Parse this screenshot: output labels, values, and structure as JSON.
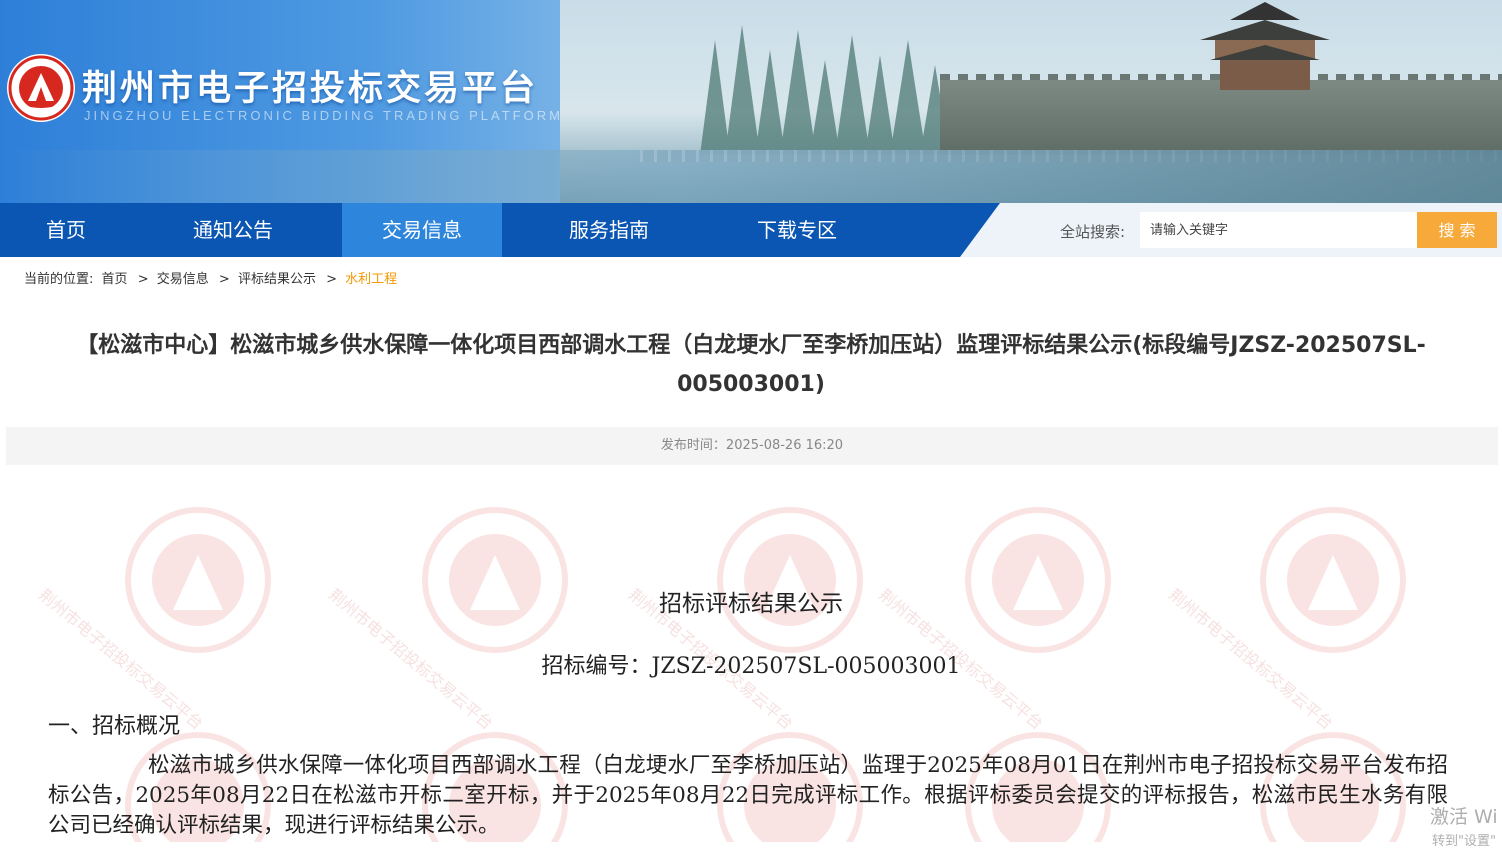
{
  "header": {
    "site_title": "荆州市电子招投标交易平台",
    "site_subtitle": "JINGZHOU ELECTRONIC BIDDING TRADING PLATFORM"
  },
  "nav": {
    "items": [
      {
        "label": "首页"
      },
      {
        "label": "通知公告"
      },
      {
        "label": "交易信息"
      },
      {
        "label": "服务指南"
      },
      {
        "label": "下载专区"
      }
    ],
    "active": "交易信息"
  },
  "search": {
    "label": "全站搜索:",
    "placeholder": "请输入关键字",
    "button": "搜 索"
  },
  "breadcrumb": {
    "prefix": "当前的位置:",
    "items": [
      "首页",
      "交易信息",
      "评标结果公示",
      "水利工程"
    ],
    "separator": ">"
  },
  "article": {
    "title": "【松滋市中心】松滋市城乡供水保障一体化项目西部调水工程（白龙埂水厂至李桥加压站）监理评标结果公示(标段编号JZSZ-202507SL-005003001)",
    "publish_time": "发布时间：2025-08-26 16:20"
  },
  "document": {
    "heading": "招标评标结果公示",
    "code": "招标编号：JZSZ-202507SL-005003001",
    "section_1_title": "一、招标概况",
    "section_1_text": "松滋市城乡供水保障一体化项目西部调水工程（白龙埂水厂至李桥加压站）监理于2025年08月01日在荆州市电子招投标交易平台发布招标公告，2025年08月22日在松滋市开标二室开标，并于2025年08月22日完成评标工作。根据评标委员会提交的评标报告，松滋市民生水务有限公司已经确认评标结果，现进行评标结果公示。"
  },
  "watermark": {
    "text": "荆州市电子招投标交易云平台"
  },
  "os_overlay": {
    "line1": "激活 Wi",
    "line2": "转到\"设置\""
  },
  "colors": {
    "nav_blue": "#0b56b3",
    "nav_active": "#2e86dc",
    "search_button": "#f7a93a",
    "breadcrumb_current": "#f39800"
  }
}
